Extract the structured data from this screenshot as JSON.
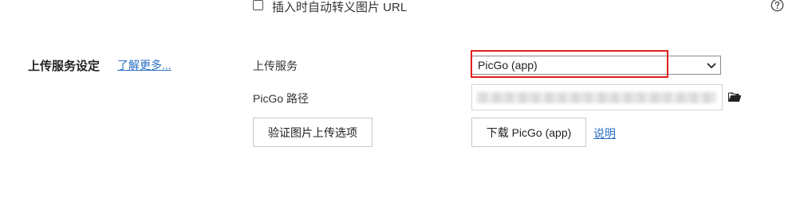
{
  "top_option": {
    "checkbox_label": "插入时自动转义图片 URL",
    "checked": false
  },
  "help": {
    "icon": "question-circle-icon"
  },
  "section": {
    "title": "上传服务设定",
    "learn_more": "了解更多..."
  },
  "upload_service": {
    "label": "上传服务",
    "selected": "PicGo (app)"
  },
  "picgo_path": {
    "label": "PicGo 路径",
    "value": ""
  },
  "buttons": {
    "verify": "验证图片上传选项",
    "download": "下载 PicGo (app)",
    "explain": "说明"
  },
  "colors": {
    "link": "#2a6fc4",
    "highlight": "#e0201c"
  }
}
